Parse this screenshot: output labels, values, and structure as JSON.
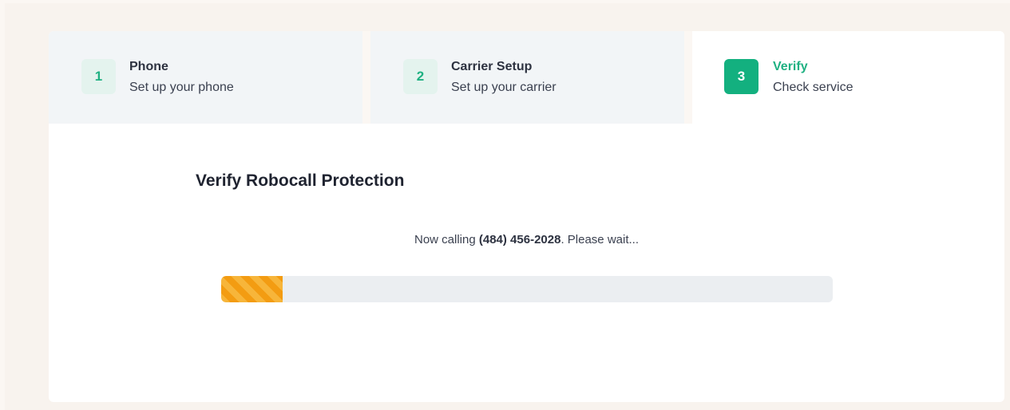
{
  "steps": [
    {
      "number": "1",
      "title": "Phone",
      "subtitle": "Set up your phone",
      "state": "inactive"
    },
    {
      "number": "2",
      "title": "Carrier Setup",
      "subtitle": "Set up your carrier",
      "state": "inactive"
    },
    {
      "number": "3",
      "title": "Verify",
      "subtitle": "Check service",
      "state": "active"
    }
  ],
  "section": {
    "title": "Verify Robocall Protection"
  },
  "status": {
    "prefix": "Now calling ",
    "phone": "(484) 456-2028",
    "suffix": ". Please wait..."
  },
  "progress": {
    "fraction": 0.1,
    "fill_color": "#f9a825",
    "track_color": "#ebeef1"
  },
  "colors": {
    "accent": "#13b07f",
    "accent_text": "#1fb182",
    "step_inactive_bg": "#f2f5f7"
  }
}
